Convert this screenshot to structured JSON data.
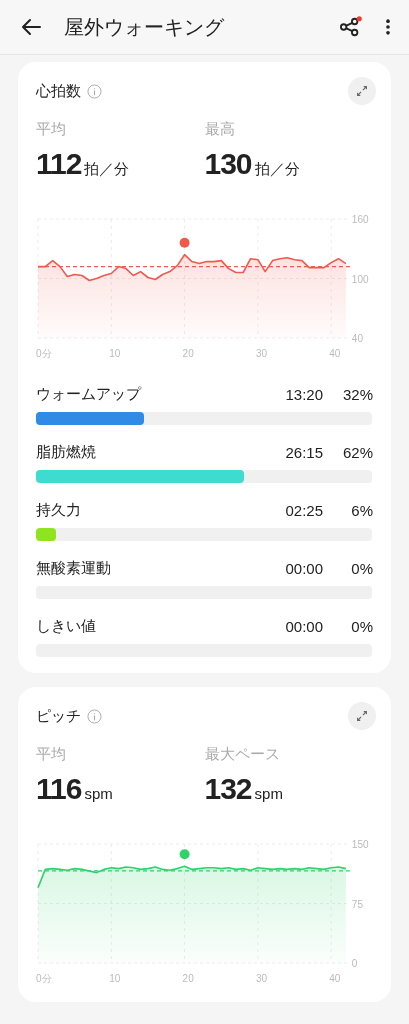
{
  "header": {
    "title": "屋外ウォーキング",
    "share_badge": true
  },
  "heart_rate": {
    "title": "心拍数",
    "stats": [
      {
        "label": "平均",
        "value": "112",
        "unit": "拍／分"
      },
      {
        "label": "最高",
        "value": "130",
        "unit": "拍／分"
      }
    ],
    "chart_data": {
      "type": "area",
      "x": [
        0,
        1,
        2,
        3,
        4,
        5,
        6,
        7,
        8,
        9,
        10,
        11,
        12,
        13,
        14,
        15,
        16,
        17,
        18,
        19,
        20,
        21,
        22,
        23,
        24,
        25,
        26,
        27,
        28,
        29,
        30,
        31,
        32,
        33,
        34,
        35,
        36,
        37,
        38,
        39,
        40,
        41,
        42
      ],
      "series": [
        {
          "color": "#ef5a4c",
          "values": [
            112,
            112,
            118,
            112,
            102,
            104,
            103,
            98,
            100,
            103,
            105,
            112,
            110,
            103,
            107,
            101,
            99,
            104,
            107,
            113,
            124,
            117,
            115,
            117,
            117,
            118,
            110,
            106,
            106,
            120,
            119,
            107,
            118,
            120,
            121,
            119,
            118,
            111,
            111,
            111,
            116,
            120,
            115
          ]
        }
      ],
      "xlim": [
        0,
        42
      ],
      "ylim": [
        40,
        160
      ],
      "yticks": [
        40,
        100,
        160
      ],
      "xticks": [
        {
          "value": 0,
          "label": "0分"
        },
        10,
        20,
        30,
        40
      ],
      "grid": true,
      "ref_lines": [
        {
          "axis": "y",
          "value": 112
        }
      ]
    },
    "zones": [
      {
        "label": "ウォームアップ",
        "time": "13:20",
        "percent": "32%",
        "level": 0.32,
        "color": "#2f8be6"
      },
      {
        "label": "脂肪燃焼",
        "time": "26:15",
        "percent": "62%",
        "level": 0.62,
        "color": "#3ddbd0"
      },
      {
        "label": "持久力",
        "time": "02:25",
        "percent": "6%",
        "level": 0.06,
        "color": "#8ee51f"
      },
      {
        "label": "無酸素運動",
        "time": "00:00",
        "percent": "0%"
      },
      {
        "label": "しきい値",
        "time": "00:00",
        "percent": "0%"
      }
    ]
  },
  "cadence": {
    "title": "ピッチ",
    "stats": [
      {
        "label": "平均",
        "value": "116",
        "unit": "spm"
      },
      {
        "label": "最大ペース",
        "value": "132",
        "unit": "spm"
      }
    ],
    "chart_data": {
      "type": "area",
      "x": [
        0,
        1,
        2,
        3,
        4,
        5,
        6,
        7,
        8,
        9,
        10,
        11,
        12,
        13,
        14,
        15,
        16,
        17,
        18,
        19,
        20,
        21,
        22,
        23,
        24,
        25,
        26,
        27,
        28,
        29,
        30,
        31,
        32,
        33,
        34,
        35,
        36,
        37,
        38,
        39,
        40,
        41,
        42
      ],
      "series": [
        {
          "color": "#2ed36a",
          "values": [
            95,
            118,
            119,
            118,
            117,
            119,
            118,
            116,
            114,
            118,
            120,
            119,
            121,
            120,
            118,
            119,
            121,
            118,
            117,
            119,
            122,
            118,
            119,
            120,
            120,
            119,
            120,
            118,
            119,
            117,
            120,
            119,
            118,
            119,
            118,
            119,
            118,
            120,
            119,
            118,
            120,
            121,
            119
          ]
        }
      ],
      "xlim": [
        0,
        42
      ],
      "ylim": [
        0,
        150
      ],
      "yticks": [
        0,
        75,
        150
      ],
      "xticks": [
        {
          "value": 0,
          "label": "0分"
        },
        10,
        20,
        30,
        40
      ],
      "grid": true,
      "ref_lines": [
        {
          "axis": "y",
          "value": 116
        }
      ]
    }
  }
}
